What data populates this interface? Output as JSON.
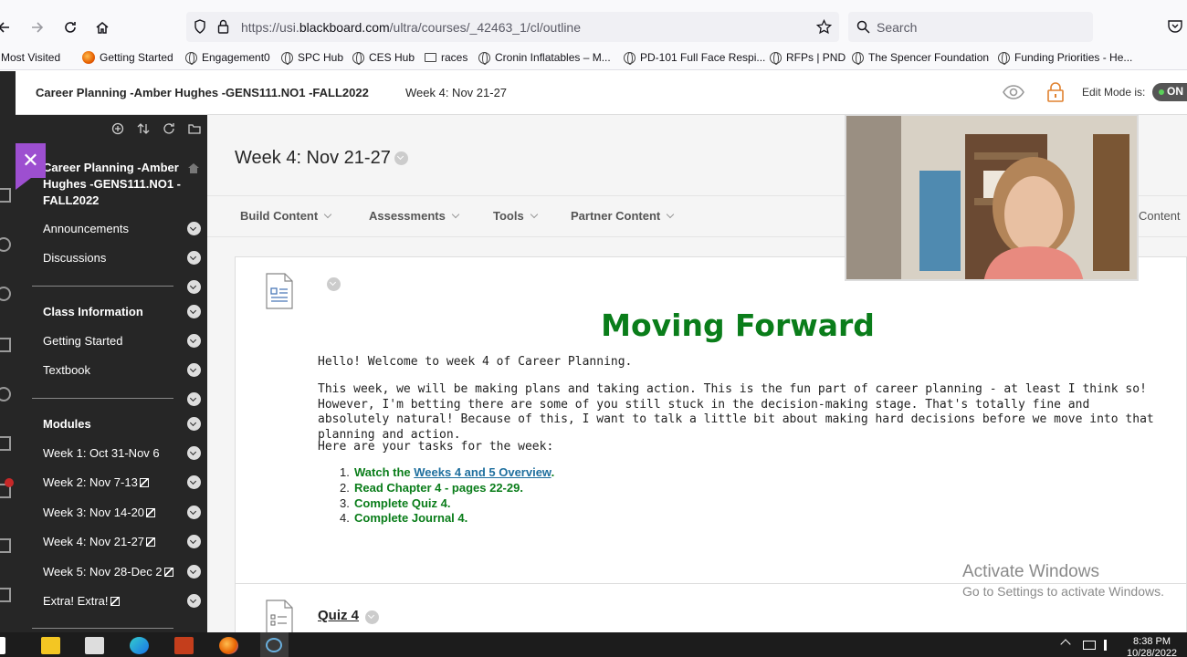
{
  "browser": {
    "url_prefix": "https://usi.",
    "url_domain": "blackboard.com",
    "url_path": "/ultra/courses/_42463_1/cl/outline",
    "search_placeholder": "Search"
  },
  "bookmarks": [
    "Most Visited",
    "Getting Started",
    "Engagement0",
    "SPC Hub",
    "CES Hub",
    "races",
    "Cronin Inflatables – M...",
    "PD-101 Full Face Respi...",
    "RFPs | PND",
    "The Spencer Foundation",
    "Funding Priorities - He..."
  ],
  "course_header": {
    "title": "Career Planning -Amber Hughes -GENS111.NO1 -FALL2022",
    "week": "Week 4: Nov 21-27",
    "edit_mode_label": "Edit Mode is:",
    "edit_mode_value": "ON"
  },
  "sidebar": {
    "course_name": "Career Planning -Amber Hughes -GENS111.NO1 -FALL2022",
    "items": [
      {
        "label": "Announcements"
      },
      {
        "label": "Discussions"
      },
      {
        "label": "Class Information"
      },
      {
        "label": "Getting Started"
      },
      {
        "label": "Textbook"
      },
      {
        "label": "Modules"
      },
      {
        "label": "Week 1: Oct 31-Nov 6"
      },
      {
        "label": "Week 2: Nov 7-13"
      },
      {
        "label": "Week 3: Nov 14-20"
      },
      {
        "label": "Week 4: Nov 21-27"
      },
      {
        "label": "Week 5: Nov 28-Dec 2"
      },
      {
        "label": "Extra! Extra!"
      }
    ]
  },
  "content": {
    "page_title": "Week 4: Nov 21-27",
    "actions": [
      "Build Content",
      "Assessments",
      "Tools",
      "Partner Content"
    ],
    "right_action": "Content",
    "item_title": "Moving Forward",
    "p1": "Hello! Welcome to week 4 of Career Planning.",
    "p2": "This week, we will be making plans and taking action. This is the fun part of career planning - at least I think so! However, I'm betting there are some of you still stuck in the decision-making stage. That's totally fine and absolutely natural! Because of this, I want to talk a little bit about making hard decisions before we move into that planning and action.",
    "p3": "Here are your tasks for the week:",
    "task1_pre": "Watch the ",
    "task1_link": "Weeks 4 and 5 Overview",
    "task1_post": ".",
    "task2": "Read Chapter 4 - pages 22-29.",
    "task3": "Complete Quiz 4.",
    "task4": "Complete Journal 4.",
    "quiz_title": "Quiz 4"
  },
  "watermark": {
    "line1": "Activate Windows",
    "line2": "Go to Settings to activate Windows."
  },
  "taskbar": {
    "time": "8:38 PM",
    "date": "10/28/2022"
  }
}
